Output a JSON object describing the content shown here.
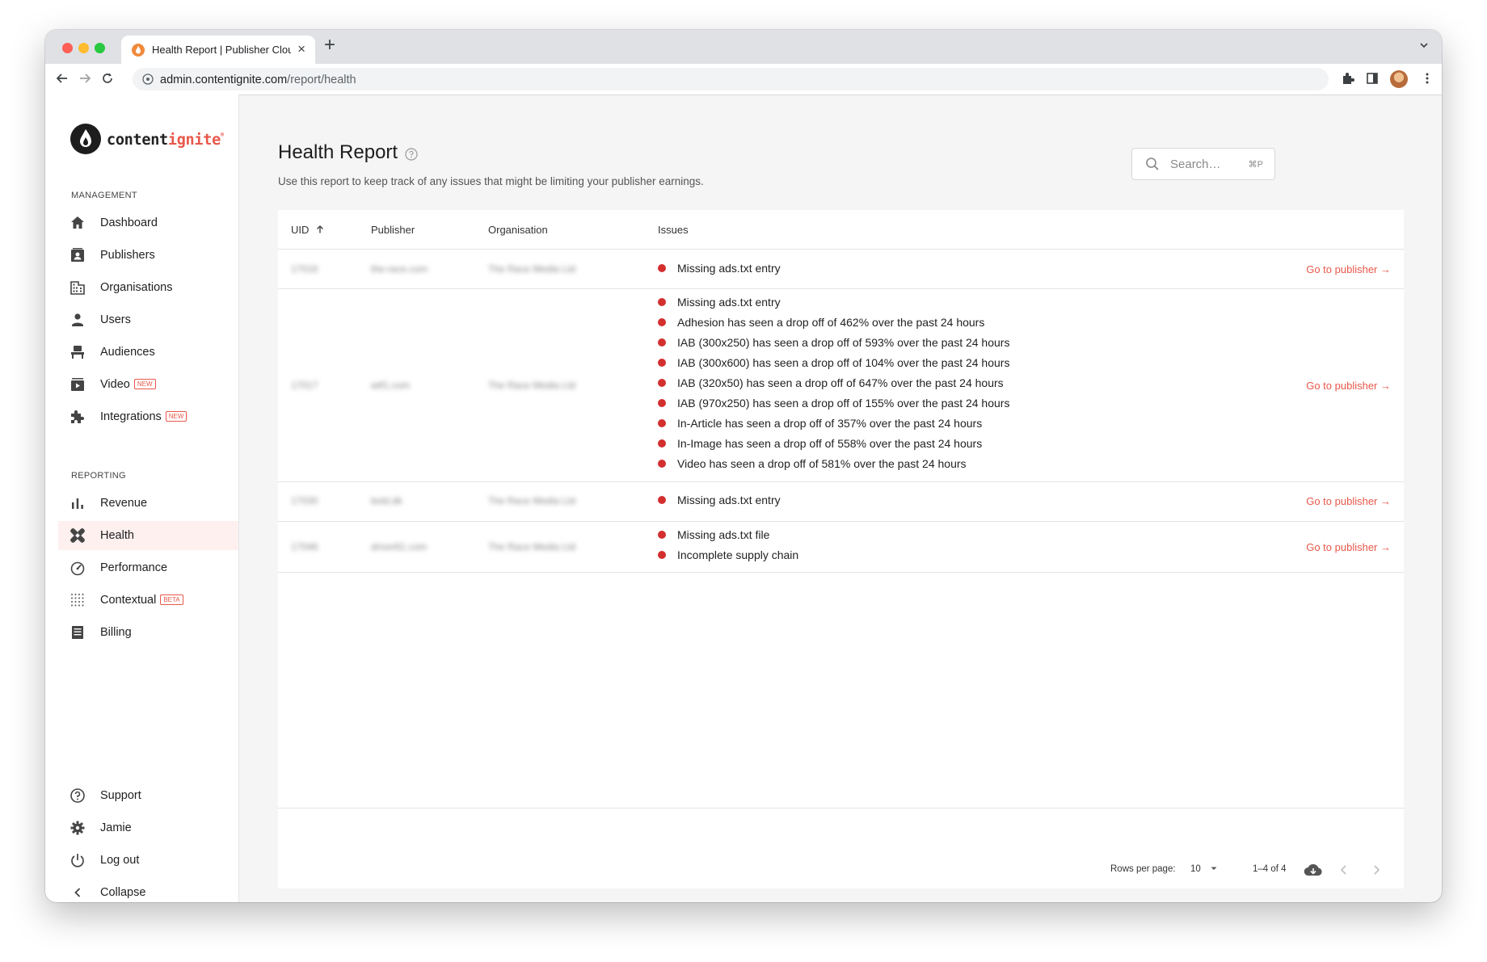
{
  "browser": {
    "tab_title": "Health Report | Publisher Cloud",
    "url_host": "admin.contentignite.com",
    "url_path": "/report/health"
  },
  "brand": {
    "name_part1": "content",
    "name_part2": "ignite",
    "accent_color": "#e8584a"
  },
  "sidebar": {
    "management_label": "MANAGEMENT",
    "management_items": [
      {
        "label": "Dashboard",
        "icon": "home-icon"
      },
      {
        "label": "Publishers",
        "icon": "publisher-card-icon"
      },
      {
        "label": "Organisations",
        "icon": "building-icon"
      },
      {
        "label": "Users",
        "icon": "person-icon"
      },
      {
        "label": "Audiences",
        "icon": "audience-icon"
      },
      {
        "label": "Video",
        "icon": "video-icon",
        "badge": "NEW"
      },
      {
        "label": "Integrations",
        "icon": "puzzle-icon",
        "badge": "NEW"
      }
    ],
    "reporting_label": "REPORTING",
    "reporting_items": [
      {
        "label": "Revenue",
        "icon": "bar-chart-icon"
      },
      {
        "label": "Health",
        "icon": "bandage-icon",
        "active": true
      },
      {
        "label": "Performance",
        "icon": "speedometer-icon"
      },
      {
        "label": "Contextual",
        "icon": "dot-grid-icon",
        "badge": "BETA"
      },
      {
        "label": "Billing",
        "icon": "receipt-icon"
      }
    ],
    "bottom_items": [
      {
        "label": "Support",
        "icon": "help-circle-icon"
      },
      {
        "label": "Jamie",
        "icon": "gear-icon"
      },
      {
        "label": "Log out",
        "icon": "power-icon"
      },
      {
        "label": "Collapse",
        "icon": "chevron-left-icon"
      }
    ]
  },
  "page": {
    "title": "Health Report",
    "description": "Use this report to keep track of any issues that might be limiting your publisher earnings.",
    "search_placeholder": "Search…",
    "search_shortcut": "⌘P"
  },
  "table": {
    "columns": [
      "UID",
      "Publisher",
      "Organisation",
      "Issues"
    ],
    "sorted_column": "UID",
    "sort_direction": "ascending",
    "link_label": "Go to publisher →",
    "rows": [
      {
        "uid": "17016",
        "publisher": "the-race.com",
        "organisation": "The Race Media Ltd",
        "issues": [
          "Missing ads.txt entry"
        ]
      },
      {
        "uid": "17017",
        "publisher": "wtf1.com",
        "organisation": "The Race Media Ltd",
        "issues": [
          "Missing ads.txt entry",
          "Adhesion has seen a drop off of 462% over the past 24 hours",
          "IAB (300x250) has seen a drop off of 593% over the past 24 hours",
          "IAB (300x600) has seen a drop off of 104% over the past 24 hours",
          "IAB (320x50) has seen a drop off of 647% over the past 24 hours",
          "IAB (970x250) has seen a drop off of 155% over the past 24 hours",
          "In-Article has seen a drop off of 357% over the past 24 hours",
          "In-Image has seen a drop off of 558% over the past 24 hours",
          "Video has seen a drop off of 581% over the past 24 hours"
        ]
      },
      {
        "uid": "17030",
        "publisher": "bold.dk",
        "organisation": "The Race Media Ltd",
        "issues": [
          "Missing ads.txt entry"
        ]
      },
      {
        "uid": "17046",
        "publisher": "driver61.com",
        "organisation": "The Race Media Ltd",
        "issues": [
          "Missing ads.txt file",
          "Incomplete supply chain"
        ]
      }
    ]
  },
  "pagination": {
    "rows_per_page_label": "Rows per page:",
    "rows_per_page_value": "10",
    "range_text": "1–4 of 4"
  },
  "colors": {
    "issue_dot": "#d32f2f",
    "active_nav_bg": "#fdf0ef"
  }
}
